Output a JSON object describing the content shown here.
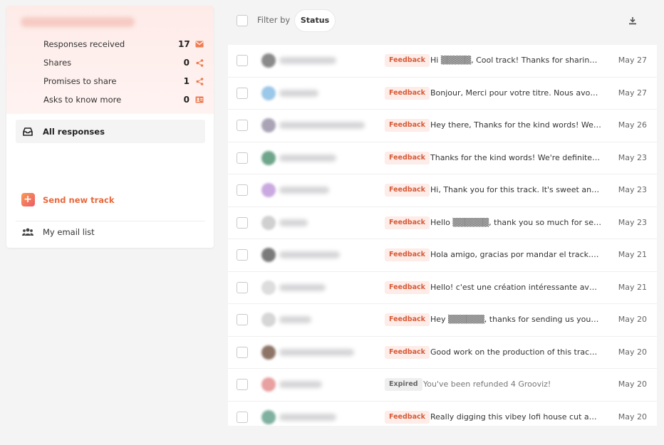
{
  "sidebar": {
    "stats": [
      {
        "label": "Responses received",
        "count": "17",
        "icon": "mail-icon"
      },
      {
        "label": "Shares",
        "count": "0",
        "icon": "share-icon"
      },
      {
        "label": "Promises to share",
        "count": "1",
        "icon": "share-icon"
      },
      {
        "label": "Asks to know more",
        "count": "0",
        "icon": "contact-card-icon"
      }
    ],
    "nav": {
      "all_responses": "All responses",
      "send_new_track": "Send new track",
      "email_list": "My email list"
    }
  },
  "toolbar": {
    "filter_label": "Filter by",
    "status_button": "Status"
  },
  "colors": {
    "accent": "#e8673a",
    "feedback_tag_bg": "#fdece7",
    "feedback_tag_text": "#d65a38"
  },
  "responses": [
    {
      "tag": "Feedback",
      "preview": "Hi ▒▒▒▒▒, Cool track! Thanks for sharing y...",
      "date": "May 27",
      "avatar_color": "#8a8a8a"
    },
    {
      "tag": "Feedback",
      "preview": "Bonjour, Merci pour votre titre. Nous avons é...",
      "date": "May 27",
      "avatar_color": "#9bc7e8"
    },
    {
      "tag": "Feedback",
      "preview": "Hey there, Thanks for the kind words! We de...",
      "date": "May 26",
      "avatar_color": "#a9a3b5"
    },
    {
      "tag": "Feedback",
      "preview": "Thanks for the kind words! We're definitely o...",
      "date": "May 23",
      "avatar_color": "#6fa58a"
    },
    {
      "tag": "Feedback",
      "preview": "Hi, Thank you for this track. It's sweet and be...",
      "date": "May 23",
      "avatar_color": "#c9a9e0"
    },
    {
      "tag": "Feedback",
      "preview": "Hello ▒▒▒▒▒▒, thank you so much for sendi...",
      "date": "May 23",
      "avatar_color": "#d0d0d0"
    },
    {
      "tag": "Feedback",
      "preview": "Hola amigo, gracias por mandar el track. Cre...",
      "date": "May 21",
      "avatar_color": "#7a7a7a"
    },
    {
      "tag": "Feedback",
      "preview": "Hello! c'est une création intéressante avec un...",
      "date": "May 21",
      "avatar_color": "#dddddd"
    },
    {
      "tag": "Feedback",
      "preview": "Hey ▒▒▒▒▒▒, thanks for sending us your ne...",
      "date": "May 20",
      "avatar_color": "#d6d6d6"
    },
    {
      "tag": "Feedback",
      "preview": "Good work on the production of this track. B...",
      "date": "May 20",
      "avatar_color": "#8d7466"
    },
    {
      "tag": "Expired",
      "preview": "You've been refunded 4 Grooviz!",
      "date": "May 20",
      "avatar_color": "#e8a0a0"
    },
    {
      "tag": "Feedback",
      "preview": "Really digging this vibey lofi house cut and d...",
      "date": "May 20",
      "avatar_color": "#7fb0a0"
    }
  ]
}
